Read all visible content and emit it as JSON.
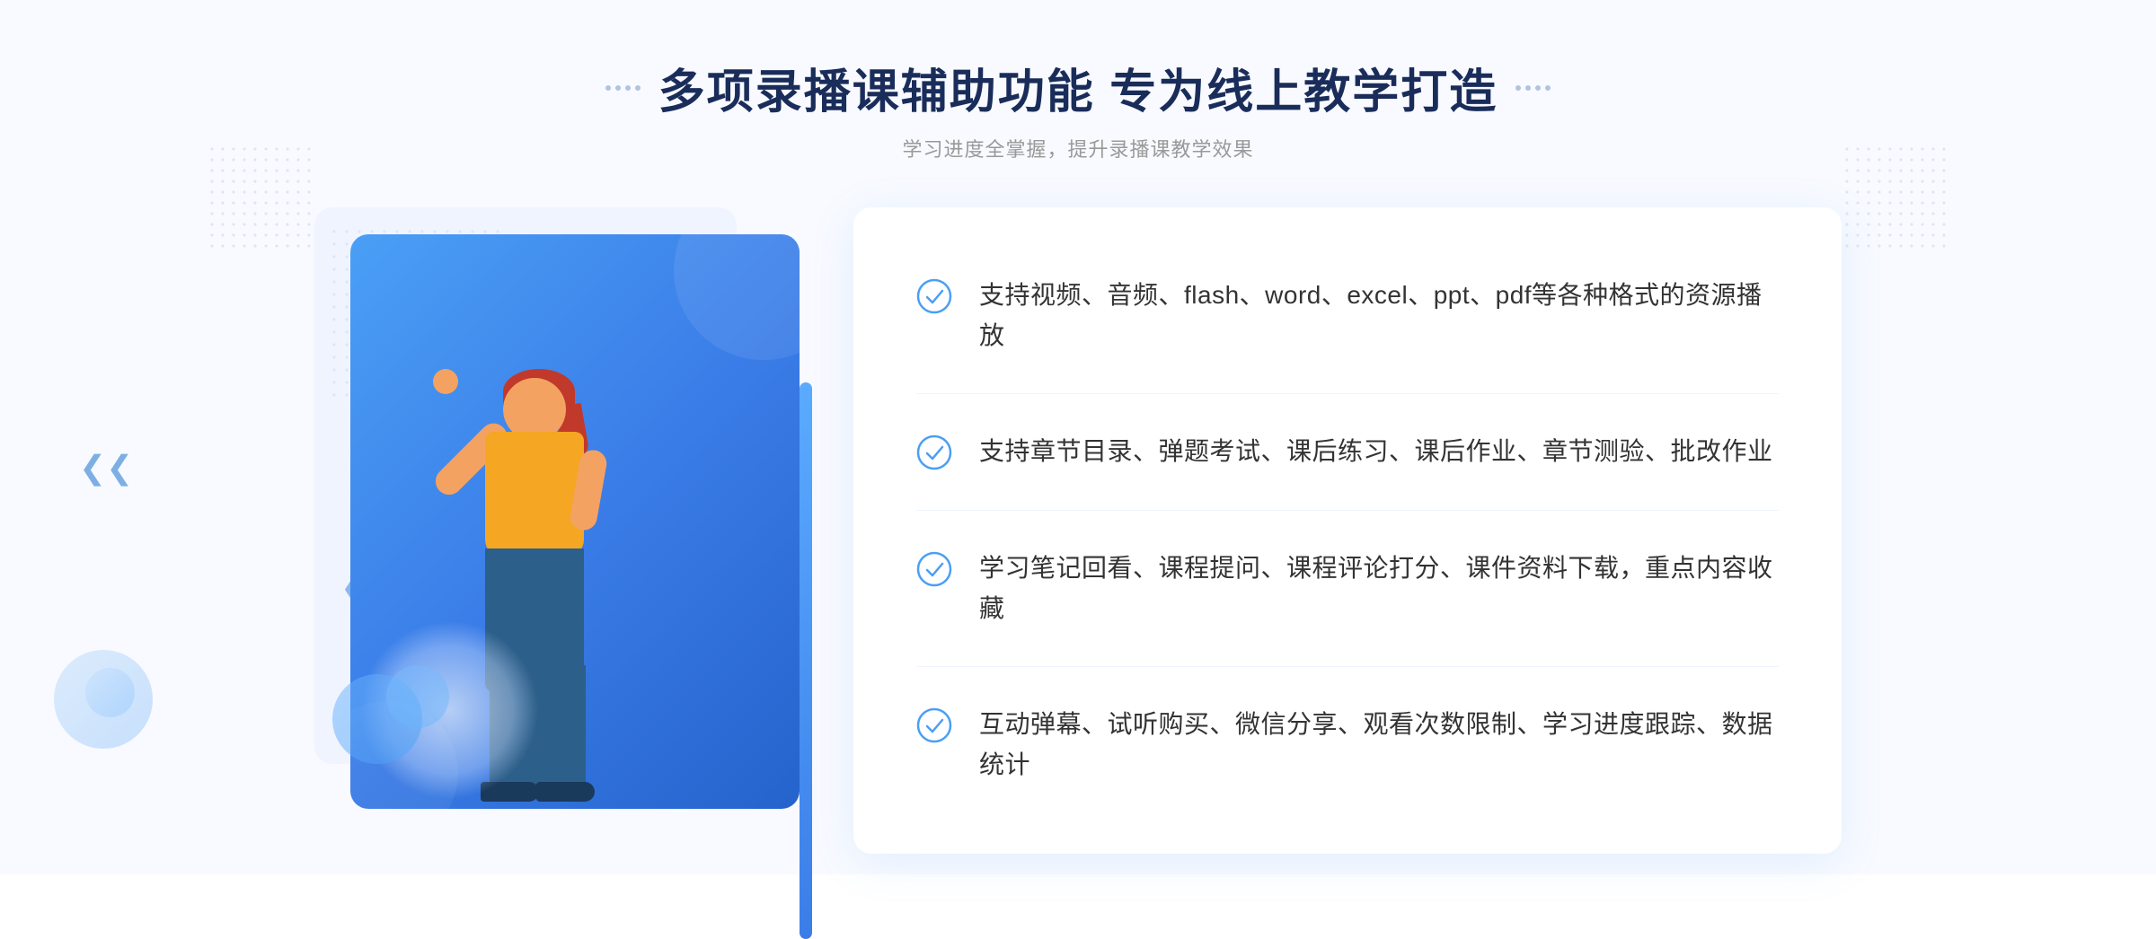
{
  "header": {
    "title": "多项录播课辅助功能 专为线上教学打造",
    "subtitle": "学习进度全掌握，提升录播课教学效果"
  },
  "decorator_left": "❮❮",
  "features": [
    {
      "id": 1,
      "text": "支持视频、音频、flash、word、excel、ppt、pdf等各种格式的资源播放"
    },
    {
      "id": 2,
      "text": "支持章节目录、弹题考试、课后练习、课后作业、章节测验、批改作业"
    },
    {
      "id": 3,
      "text": "学习笔记回看、课程提问、课程评论打分、课件资料下载，重点内容收藏"
    },
    {
      "id": 4,
      "text": "互动弹幕、试听购买、微信分享、观看次数限制、学习进度跟踪、数据统计"
    }
  ]
}
